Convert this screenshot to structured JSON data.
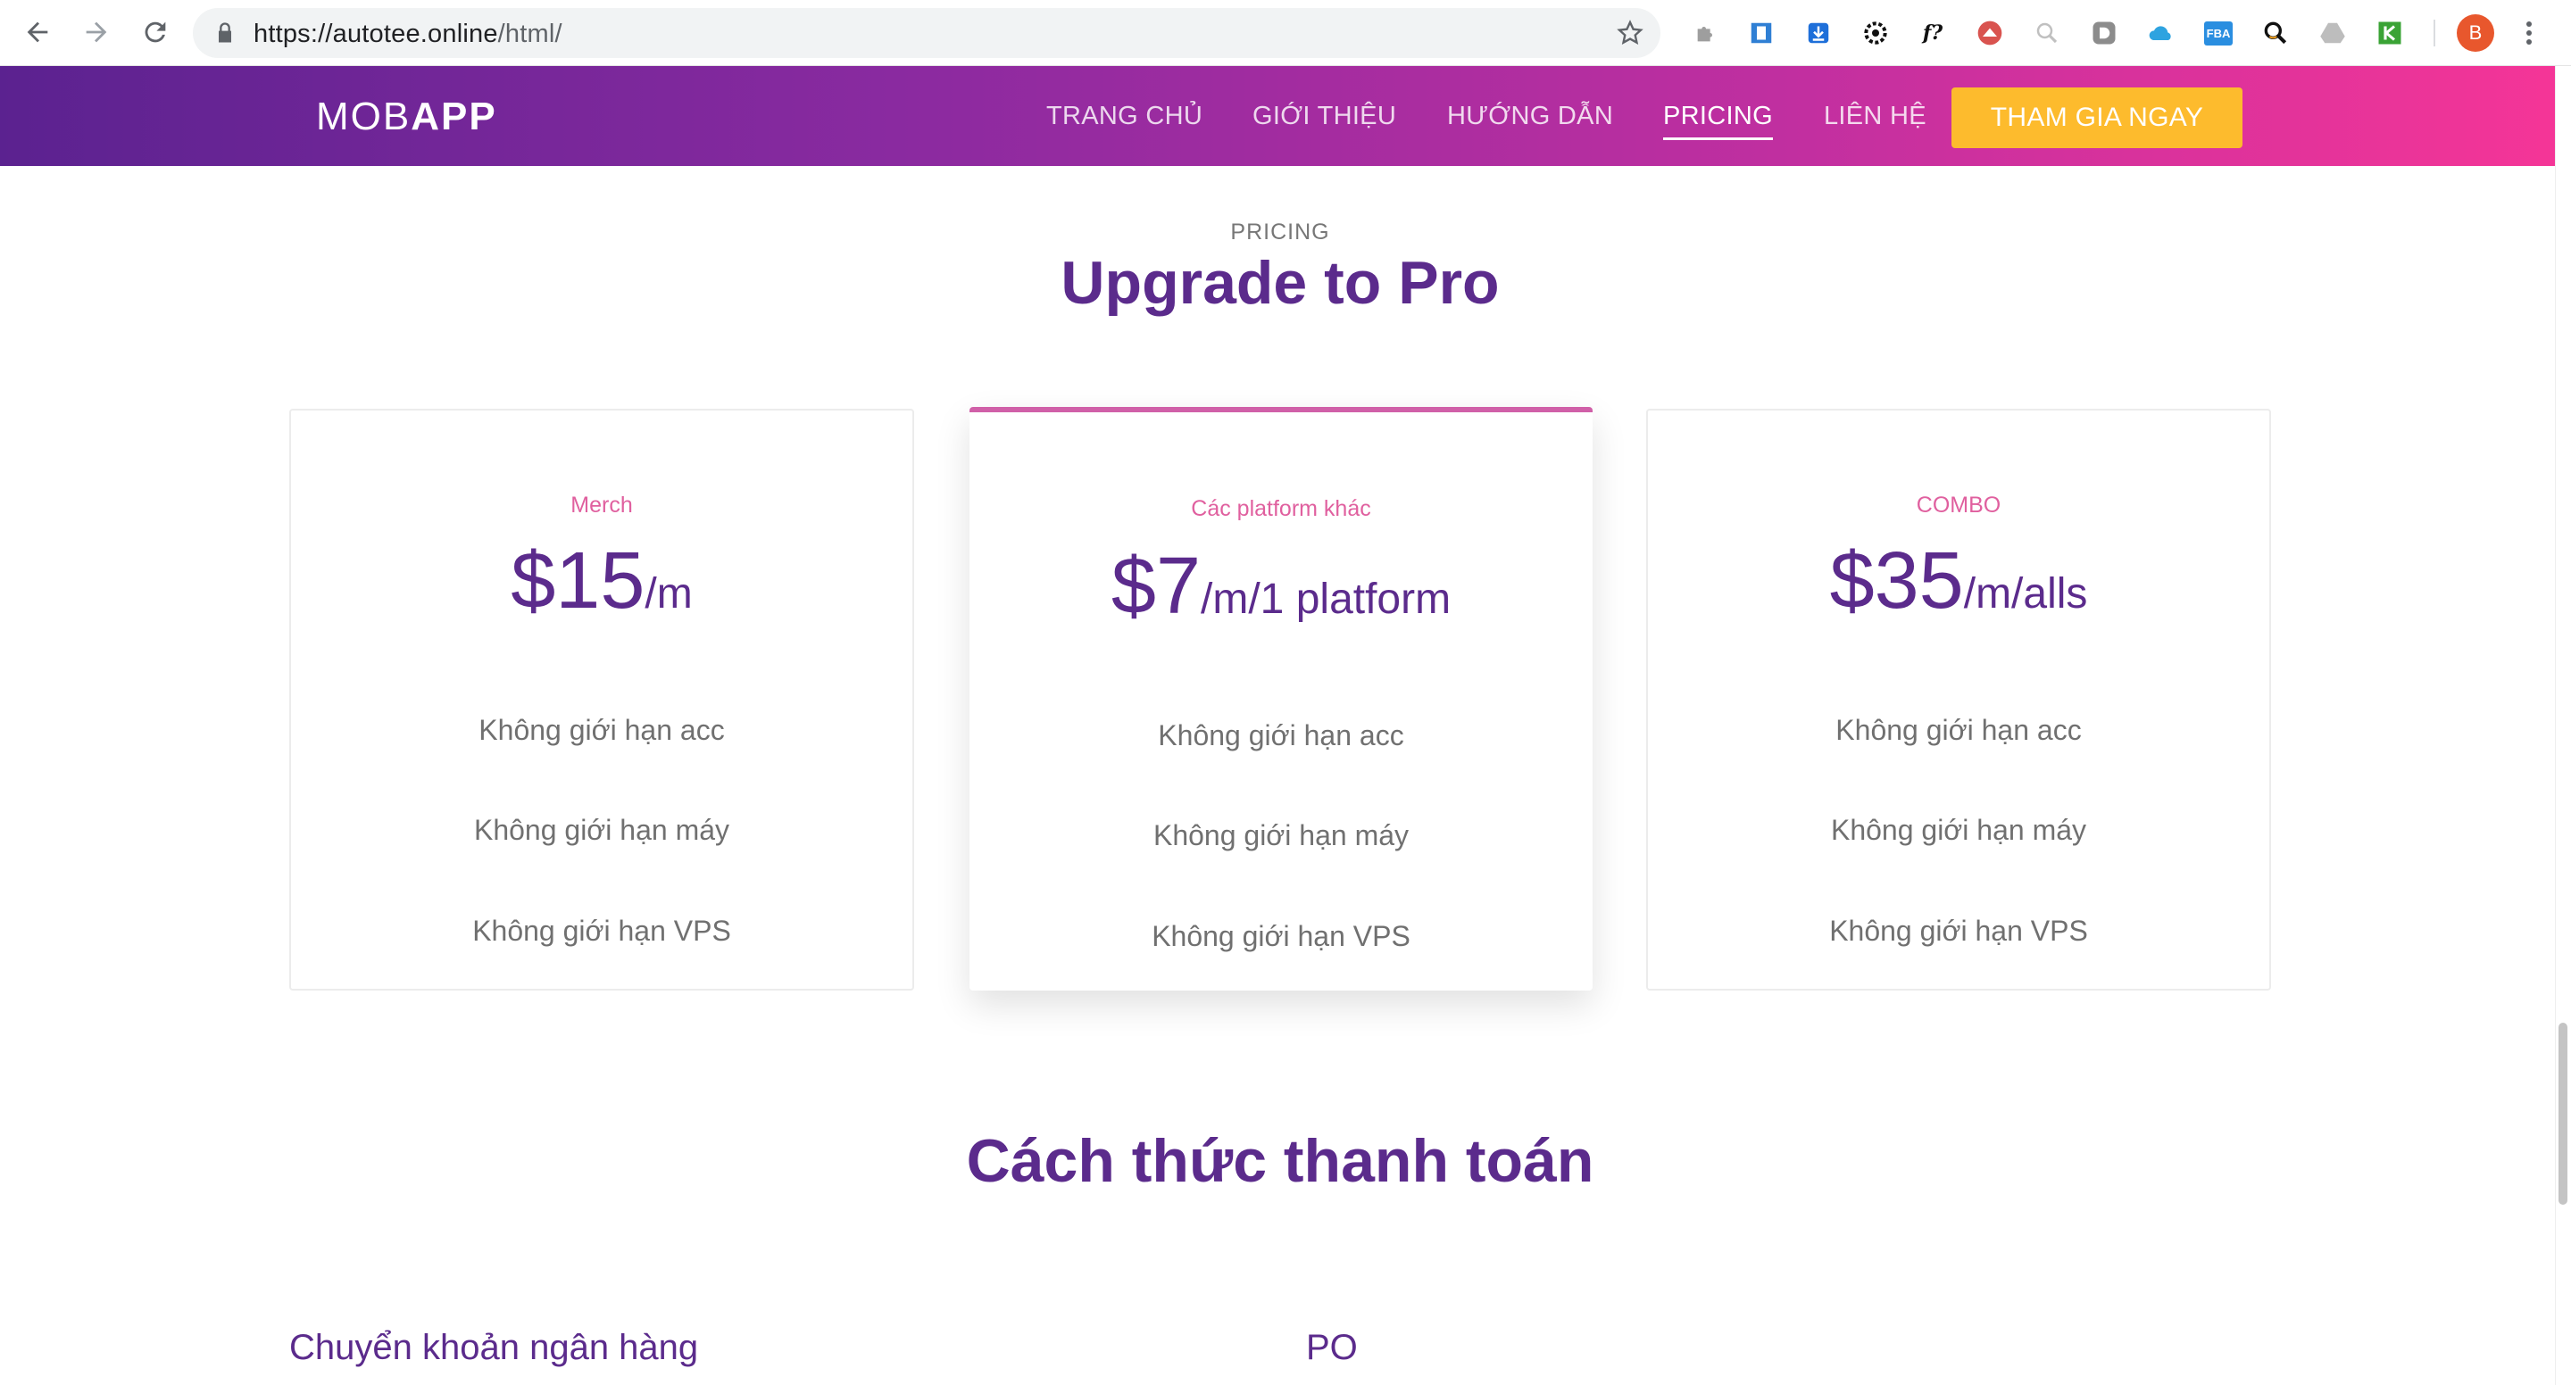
{
  "browser": {
    "url_host": "https://autotee.online",
    "url_path": "/html/",
    "profile_initial": "B",
    "extensions": [
      "puzzle-icon",
      "bookmark-ext-icon",
      "download-ext-icon",
      "gear-ext-icon",
      "formula-ext-icon",
      "shield-ext-icon",
      "zoom-ext-icon",
      "d-ext-icon",
      "cloud-ext-icon",
      "fba-ext-icon",
      "amazon-search-ext-icon",
      "drive-ext-icon",
      "k-ext-icon"
    ],
    "ext_labels": {
      "formula": "f?",
      "fba": "FBA"
    }
  },
  "header": {
    "logo_light": "MOB",
    "logo_bold": "APP",
    "nav": [
      {
        "label": "TRANG CHỦ"
      },
      {
        "label": "GIỚI THIỆU"
      },
      {
        "label": "HƯỚNG DẪN"
      },
      {
        "label": "PRICING"
      },
      {
        "label": "LIÊN HỆ"
      }
    ],
    "cta": "THAM GIA NGAY",
    "gradient": [
      "#5b2290",
      "#f53597"
    ],
    "cta_color": "#fdbb2d"
  },
  "pricing": {
    "kicker": "PRICING",
    "title": "Upgrade to Pro",
    "plans": [
      {
        "name": "Merch",
        "amount": "$15",
        "unit": "/m",
        "features": [
          "Không giới hạn acc",
          "Không giới hạn máy",
          "Không giới hạn VPS"
        ]
      },
      {
        "name": "Các platform khác",
        "amount": "$7",
        "unit": "/m/1 platform",
        "features": [
          "Không giới hạn acc",
          "Không giới hạn máy",
          "Không giới hạn VPS"
        ]
      },
      {
        "name": "COMBO",
        "amount": "$35",
        "unit": "/m/alls",
        "features": [
          "Không giới hạn acc",
          "Không giới hạn máy",
          "Không giới hạn VPS"
        ]
      }
    ]
  },
  "payment": {
    "title": "Cách thức thanh toán",
    "methods": [
      "Chuyển khoản ngân hàng",
      "PO"
    ]
  }
}
